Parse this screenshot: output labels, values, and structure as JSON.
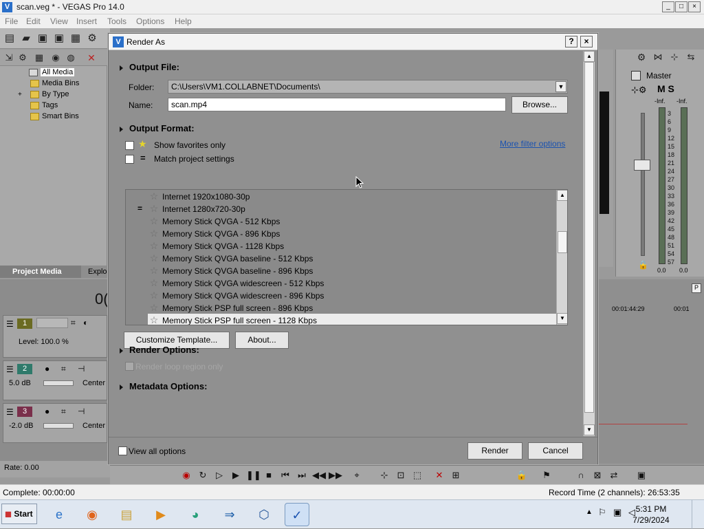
{
  "app": {
    "title": "scan.veg * - VEGAS Pro 14.0",
    "icon_label": "V",
    "window_buttons": [
      "_",
      "□",
      "×"
    ],
    "menu": [
      "File",
      "Edit",
      "View",
      "Insert",
      "Tools",
      "Options",
      "Help"
    ]
  },
  "media_tree": {
    "items": [
      {
        "label": "All Media",
        "selected": true
      },
      {
        "label": "Media Bins"
      },
      {
        "label": "By Type",
        "expander": "+"
      },
      {
        "label": "Tags"
      },
      {
        "label": "Smart Bins"
      }
    ],
    "tabs": [
      "Project Media",
      "Explo"
    ]
  },
  "timeline": {
    "time_partial": "0(",
    "tracks": [
      {
        "number": "1",
        "label": "Level: 100.0 %",
        "color": "#6b6b22"
      },
      {
        "number": "2",
        "label": "5.0 dB",
        "pan": "Center",
        "color": "#2f7a6b"
      },
      {
        "number": "3",
        "label": "-2.0 dB",
        "pan": "Center",
        "color": "#7a2f4b"
      }
    ],
    "rate": "Rate: 0.00",
    "ruler_time_1": "00:01:44:29",
    "ruler_time_2": "00:01"
  },
  "mixer": {
    "title": "Master",
    "controls": "M S",
    "inf_left": "-Inf.",
    "inf_right": "-Inf.",
    "scale": [
      "3",
      "6",
      "9",
      "12",
      "15",
      "18",
      "21",
      "24",
      "27",
      "30",
      "33",
      "36",
      "39",
      "42",
      "45",
      "48",
      "51",
      "54",
      "57"
    ],
    "readout_left": "0.0",
    "readout_right": "0.0"
  },
  "statusbar": {
    "complete": "Complete: 00:00:00",
    "record_time": "Record Time (2 channels): 26:53:35"
  },
  "taskbar": {
    "start_label": "Start",
    "time": "5:31 PM",
    "date": "7/29/2024"
  },
  "dialog": {
    "title": "Render As",
    "help_label": "?",
    "close_label": "×",
    "output_file": {
      "heading": "Output File:",
      "folder_label": "Folder:",
      "folder_value": "C:\\Users\\VM1.COLLABNET\\Documents\\",
      "name_label": "Name:",
      "name_value": "scan.mp4",
      "browse_label": "Browse..."
    },
    "output_format": {
      "heading": "Output Format:",
      "show_favorites_label": "Show favorites only",
      "match_project_label": "Match project settings",
      "more_filter_label": "More filter options",
      "templates": [
        "Internet 1920x1080-30p",
        "Internet 1280x720-30p",
        "Memory Stick QVGA - 512 Kbps",
        "Memory Stick QVGA - 896 Kbps",
        "Memory Stick QVGA - 1128 Kbps",
        "Memory Stick QVGA baseline - 512 Kbps",
        "Memory Stick QVGA baseline - 896 Kbps",
        "Memory Stick QVGA widescreen - 512 Kbps",
        "Memory Stick QVGA widescreen - 896 Kbps",
        "Memory Stick PSP full screen - 896 Kbps",
        "Memory Stick PSP full screen - 1128 Kbps"
      ],
      "selected_template": "Memory Stick PSP full screen - 1128 Kbps",
      "customize_label": "Customize Template...",
      "about_label": "About..."
    },
    "render_options": {
      "heading": "Render Options:",
      "loop_region_label": "Render loop region only"
    },
    "metadata_options": {
      "heading": "Metadata Options:"
    },
    "footer": {
      "view_all_label": "View all options",
      "render_label": "Render",
      "cancel_label": "Cancel"
    }
  }
}
